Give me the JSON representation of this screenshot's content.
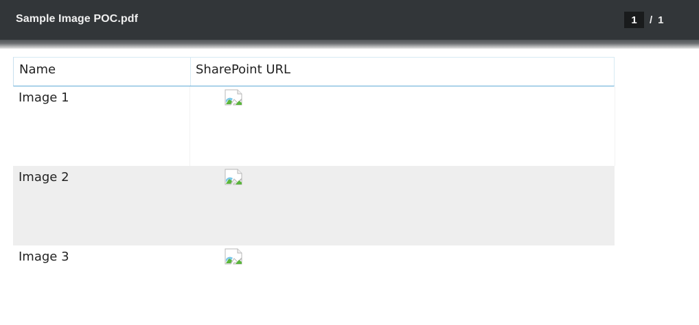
{
  "viewer": {
    "title": "Sample Image POC.pdf",
    "page_current": "1",
    "page_separator": "/",
    "page_total": "1"
  },
  "table": {
    "headers": [
      "Name",
      "SharePoint URL"
    ],
    "rows": [
      {
        "name": "Image 1",
        "url_image": "broken-image-icon"
      },
      {
        "name": "Image 2",
        "url_image": "broken-image-icon"
      },
      {
        "name": "Image 3",
        "url_image": "broken-image-icon"
      }
    ]
  },
  "colors": {
    "toolbar_bg": "#323639",
    "alt_row_bg": "#eeeeee",
    "header_border": "#5ea9d6"
  }
}
